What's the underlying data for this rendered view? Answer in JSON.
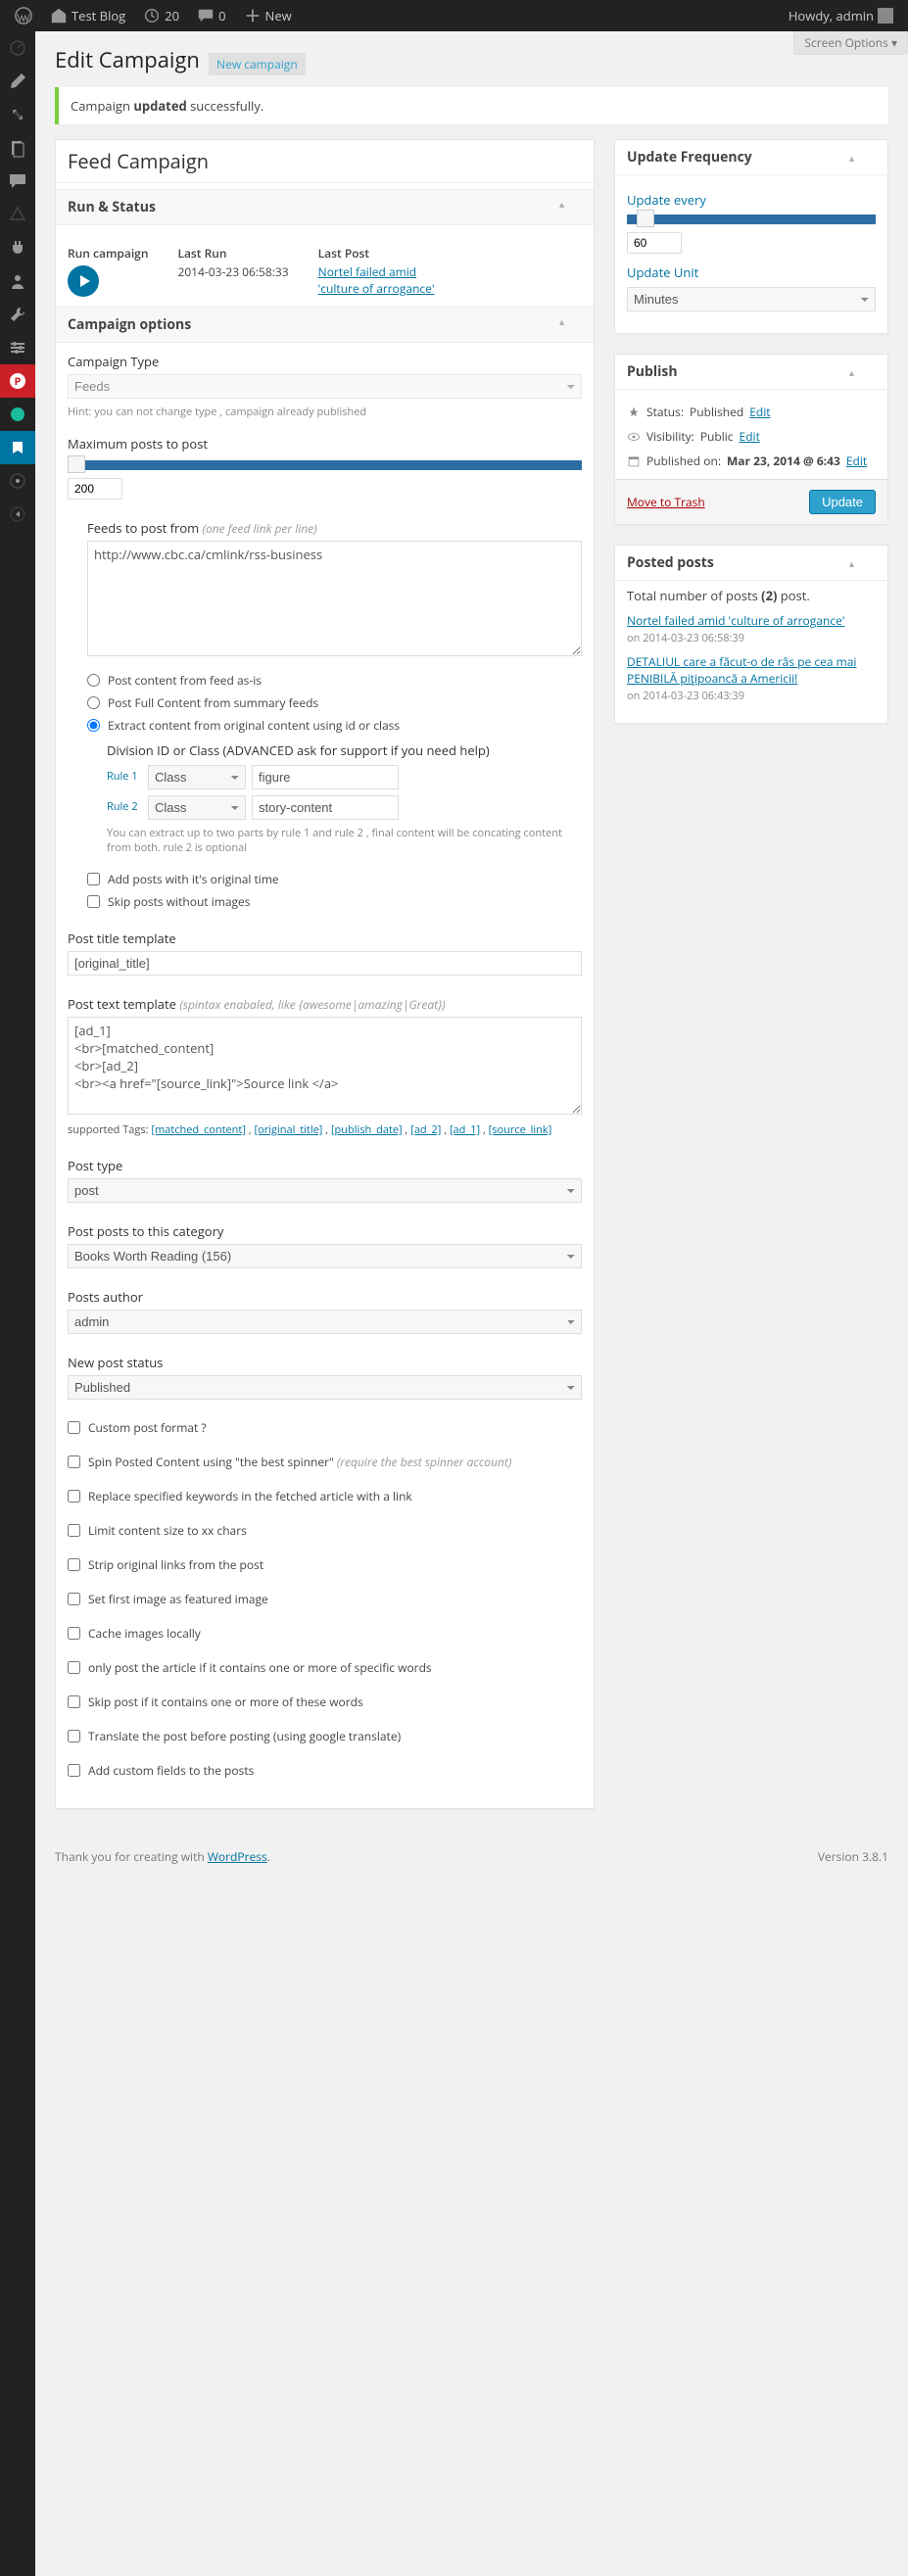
{
  "adminbar": {
    "site": "Test Blog",
    "updates": "20",
    "comments": "0",
    "new": "New",
    "howdy": "Howdy, admin"
  },
  "screen_options": "Screen Options",
  "page_title": "Edit Campaign",
  "new_campaign": "New campaign",
  "notice": {
    "prefix": "Campaign ",
    "strong": "updated",
    "suffix": " successfully."
  },
  "main": {
    "title": "Feed Campaign",
    "run_status": {
      "heading": "Run & Status",
      "run_label": "Run campaign",
      "last_run_label": "Last Run",
      "last_run": "2014-03-23 06:58:33",
      "last_post_label": "Last Post",
      "last_post": "Nortel failed amid 'culture of arrogance'"
    },
    "campaign_options": {
      "heading": "Campaign options",
      "type_label": "Campaign Type",
      "type_value": "Feeds",
      "type_hint": "Hint: you can not change type , campaign already published",
      "max_posts_label": "Maximum posts to post",
      "max_posts_value": "200",
      "feeds_label": "Feeds to post from",
      "feeds_hint": "(one feed link per line)",
      "feeds_value": "http://www.cbc.ca/cmlink/rss-business",
      "radio_asis": "Post content from feed as-is",
      "radio_full": "Post Full Content from summary feeds",
      "radio_extract": "Extract content from original content using id or class",
      "division_label": "Division ID or Class (ADVANCED ask for support if you need help)",
      "rule1_label": "Rule 1",
      "rule2_label": "Rule 2",
      "rule_type": "Class",
      "rule1_value": "figure",
      "rule2_value": "story-content",
      "rules_note": "You can extract up to two parts by rule 1 and rule 2 , final content will be concating content from both. rule 2 is optional",
      "check_original_time": "Add posts with it's original time",
      "check_skip_noimg": "Skip posts without images",
      "title_template_label": "Post title template",
      "title_template_value": "[original_title]",
      "text_template_label": "Post text template",
      "text_template_hint": "(spintax enabaled, like {awesome|amazing|Great})",
      "text_template_value": "[ad_1]\n<br>[matched_content]\n<br>[ad_2]\n<br><a href=\"[source_link]\">Source link </a>",
      "supported_prefix": "supported Tags: ",
      "supported_tags": [
        "[matched_content]",
        "[original_title]",
        "[publish_date]",
        "[ad_2]",
        "[ad_1]",
        "[source_link]"
      ],
      "post_type_label": "Post type",
      "post_type_value": "post",
      "category_label": "Post posts to this category",
      "category_value": "Books Worth Reading (156)",
      "author_label": "Posts author",
      "author_value": "admin",
      "status_label": "New post status",
      "status_value": "Published",
      "options": [
        "Custom post format ?",
        "Spin Posted Content using \"the best spinner\" (require the best spinner account)",
        "Replace specified keywords in the fetched article with a link",
        "Limit content size to xx chars",
        "Strip original links from the post",
        "Set first image as featured image",
        "Cache images locally",
        "only post the article if it contains one or more of specific words",
        "Skip post if it contains one or more of these words",
        "Translate the post before posting (using google translate)",
        "Add custom fields to the posts"
      ]
    }
  },
  "side": {
    "update_freq": {
      "heading": "Update Frequency",
      "every_label": "Update every",
      "every_value": "60",
      "unit_label": "Update Unit",
      "unit_value": "Minutes"
    },
    "publish": {
      "heading": "Publish",
      "status_label": "Status:",
      "status_value": "Published",
      "visibility_label": "Visibility:",
      "visibility_value": "Public",
      "published_on_label": "Published on:",
      "published_on_value": "Mar 23, 2014 @ 6:43",
      "edit": "Edit",
      "trash": "Move to Trash",
      "update": "Update"
    },
    "posted": {
      "heading": "Posted posts",
      "total_prefix": "Total number of posts ",
      "total_count": "(2)",
      "total_suffix": " post.",
      "items": [
        {
          "title": "Nortel failed amid 'culture of arrogance'",
          "date": "on 2014-03-23 06:58:39"
        },
        {
          "title": "DETALIUL care a făcut-o de râs pe cea mai PENIBILĂ piţipoancă a Americii!",
          "date": "on 2014-03-23 06:43:39"
        }
      ]
    }
  },
  "footer": {
    "thank_prefix": "Thank you for creating with ",
    "wp": "WordPress",
    "version": "Version 3.8.1"
  }
}
